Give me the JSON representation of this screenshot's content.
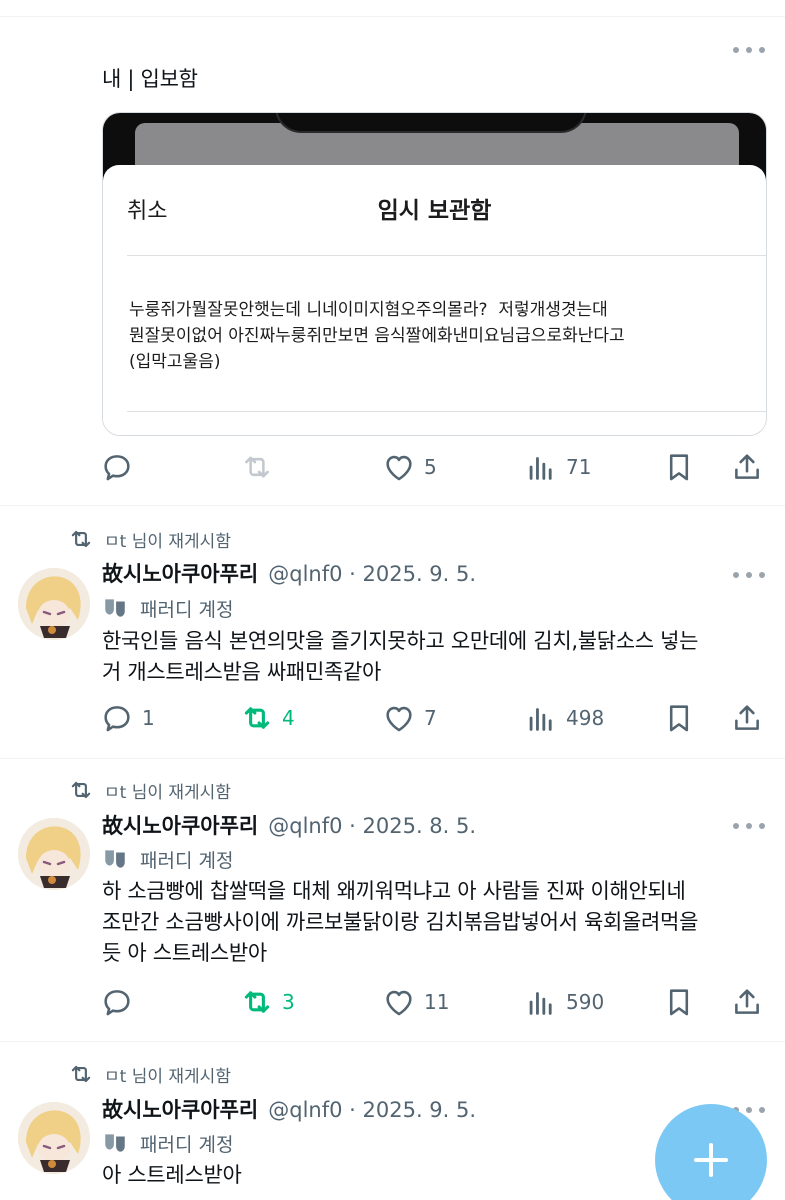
{
  "tweet0": {
    "text": "내 | 입보함",
    "embed": {
      "cancel": "취소",
      "title": "임시 보관함",
      "body": "누룽쥐가뭘잘못안햇는데 니네이미지혐오주의몰라?  저렇개생겻는대\n뭔잘못이없어 아진짜누룽쥐만보면 음식짤에화낸미요님급으로화난다고\n(입막고울음)"
    },
    "stats": {
      "replies": "",
      "retweets": "",
      "likes": "5",
      "views": "71"
    }
  },
  "tweets": [
    {
      "rt_text": "ㅁt 님이 재게시함",
      "name": "故시노아쿠아푸리",
      "handle": "@qlnf0 · 2025. 9. 5.",
      "label": "패러디 계정",
      "text": "한국인들 음식 본연의맛을 즐기지못하고 오만데에 김치,불닭소스 넣는\n거 개스트레스받음 싸패민족같아",
      "stats": {
        "replies": "1",
        "retweets": "4",
        "likes": "7",
        "views": "498"
      }
    },
    {
      "rt_text": "ㅁt 님이 재게시함",
      "name": "故시노아쿠아푸리",
      "handle": "@qlnf0 · 2025. 8. 5.",
      "label": "패러디 계정",
      "text": "하 소금빵에 찹쌀떡을 대체 왜끼워먹냐고 아 사람들 진짜 이해안되네\n조만간 소금빵사이에 까르보불닭이랑 김치볶음밥넣어서 육회올려먹을\n듯 아 스트레스받아",
      "stats": {
        "replies": "",
        "retweets": "3",
        "likes": "11",
        "views": "590"
      }
    },
    {
      "rt_text": "ㅁt 님이 재게시함",
      "name": "故시노아쿠아푸리",
      "handle": "@qlnf0 · 2025. 9. 5.",
      "label": "패러디 계정",
      "text": "아 스트레스받아"
    }
  ]
}
